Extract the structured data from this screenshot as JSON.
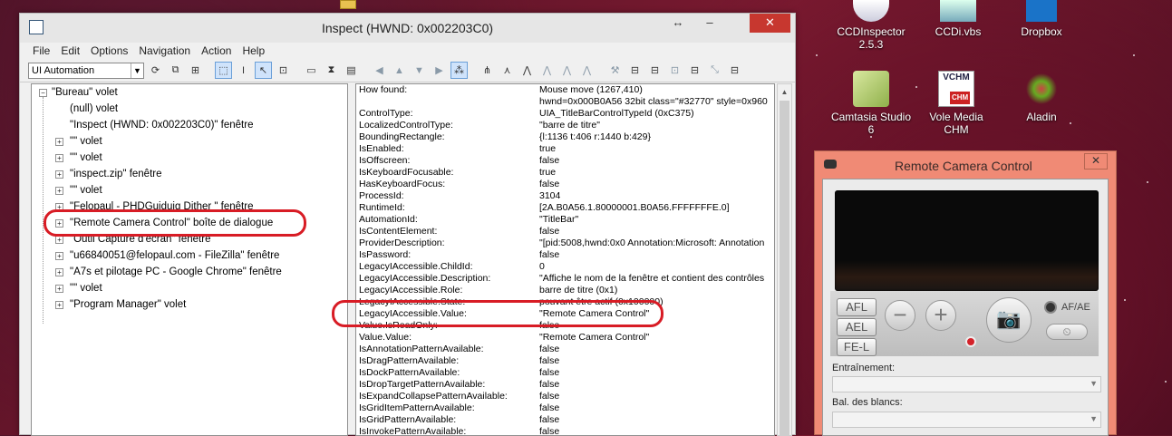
{
  "desktop": {
    "icons": [
      {
        "label": "CCDInspector 2.5.3",
        "icon": "ccdinspector-icon"
      },
      {
        "label": "CCDi.vbs",
        "icon": "script-icon"
      },
      {
        "label": "Dropbox",
        "icon": "dropbox-icon"
      },
      {
        "label": "Camtasia Studio 6",
        "icon": "camtasia-icon"
      },
      {
        "label": "Vole Media CHM",
        "icon": "chm-icon"
      },
      {
        "label": "Aladin",
        "icon": "aladin-icon"
      }
    ],
    "chm_badge": "VCHM",
    "chm_tag": "CHM"
  },
  "inspect": {
    "title": "Inspect  (HWND: 0x002203C0)",
    "menu": [
      "File",
      "Edit",
      "Options",
      "Navigation",
      "Action",
      "Help"
    ],
    "mode_combo": "UI Automation",
    "tree": [
      {
        "label": "\"Bureau\" volet",
        "expander": "−"
      },
      {
        "label": "(null) volet",
        "expander": ""
      },
      {
        "label": "\"Inspect  (HWND: 0x002203C0)\" fenêtre",
        "expander": ""
      },
      {
        "label": "\"\" volet",
        "expander": "+"
      },
      {
        "label": "\"\" volet",
        "expander": "+"
      },
      {
        "label": "\"inspect.zip\" fenêtre",
        "expander": "+"
      },
      {
        "label": "\"\" volet",
        "expander": "+"
      },
      {
        "label": "\"Felopaul - PHDGuiduig Dither \" fenêtre",
        "expander": "+"
      },
      {
        "label": "\"Remote Camera Control\" boîte de dialogue",
        "expander": "+"
      },
      {
        "label": "\"Outil Capture d'écran\" fenêtre",
        "expander": "+"
      },
      {
        "label": "\"u66840051@felopaul.com - FileZilla\" fenêtre",
        "expander": "+"
      },
      {
        "label": "\"A7s et pilotage PC - Google Chrome\" fenêtre",
        "expander": "+"
      },
      {
        "label": "\"\" volet",
        "expander": "+"
      },
      {
        "label": "\"Program Manager\" volet",
        "expander": "+"
      }
    ],
    "properties": [
      {
        "name": "How found:",
        "value": "Mouse move (1267,410)"
      },
      {
        "name": "",
        "value": "hwnd=0x000B0A56 32bit class=\"#32770\" style=0x960"
      },
      {
        "name": "ControlType:",
        "value": "UIA_TitleBarControlTypeId (0xC375)"
      },
      {
        "name": "LocalizedControlType:",
        "value": "\"barre de titre\""
      },
      {
        "name": "BoundingRectangle:",
        "value": "{l:1136 t:406 r:1440 b:429}"
      },
      {
        "name": "IsEnabled:",
        "value": "true"
      },
      {
        "name": "IsOffscreen:",
        "value": "false"
      },
      {
        "name": "IsKeyboardFocusable:",
        "value": "true"
      },
      {
        "name": "HasKeyboardFocus:",
        "value": "false"
      },
      {
        "name": "ProcessId:",
        "value": "3104"
      },
      {
        "name": "RuntimeId:",
        "value": "[2A.B0A56.1.80000001.B0A56.FFFFFFFE.0]"
      },
      {
        "name": "AutomationId:",
        "value": "\"TitleBar\""
      },
      {
        "name": "IsContentElement:",
        "value": "false"
      },
      {
        "name": "ProviderDescription:",
        "value": "\"[pid:5008,hwnd:0x0 Annotation:Microsoft: Annotation"
      },
      {
        "name": "IsPassword:",
        "value": "false"
      },
      {
        "name": "LegacyIAccessible.ChildId:",
        "value": "0"
      },
      {
        "name": "LegacyIAccessible.Description:",
        "value": "\"Affiche le nom de la fenêtre et contient des contrôles"
      },
      {
        "name": "LegacyIAccessible.Role:",
        "value": "barre de titre (0x1)"
      },
      {
        "name": "LegacyIAccessible.State:",
        "value": "pouvant être actif (0x100000)"
      },
      {
        "name": "LegacyIAccessible.Value:",
        "value": "\"Remote Camera Control\""
      },
      {
        "name": "Value.IsReadOnly:",
        "value": "false"
      },
      {
        "name": "Value.Value:",
        "value": "\"Remote Camera Control\""
      },
      {
        "name": "IsAnnotationPatternAvailable:",
        "value": "false"
      },
      {
        "name": "IsDragPatternAvailable:",
        "value": "false"
      },
      {
        "name": "IsDockPatternAvailable:",
        "value": "false"
      },
      {
        "name": "IsDropTargetPatternAvailable:",
        "value": "false"
      },
      {
        "name": "IsExpandCollapsePatternAvailable:",
        "value": "false"
      },
      {
        "name": "IsGridItemPatternAvailable:",
        "value": "false"
      },
      {
        "name": "IsGridPatternAvailable:",
        "value": "false"
      },
      {
        "name": "IsInvokePatternAvailable:",
        "value": "false"
      }
    ]
  },
  "remote": {
    "title": "Remote Camera Control",
    "afl": "AFL",
    "ael": "AEL",
    "fel": "FE-L",
    "minus": "−",
    "plus": "+",
    "afae": "AF/AE",
    "entrainement_label": "Entraînement:",
    "balance_label": "Bal. des blancs:"
  }
}
